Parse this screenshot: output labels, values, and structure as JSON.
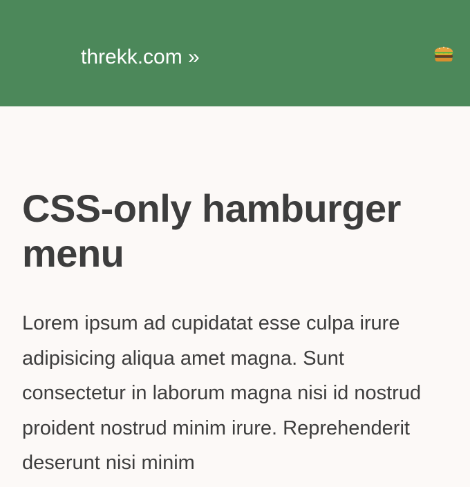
{
  "header": {
    "brand": "threkk.com »",
    "menu_icon": "hamburger-icon",
    "background": "#4c885a"
  },
  "main": {
    "title": "CSS-only hamburger menu",
    "body": "Lorem ipsum ad cupidatat esse culpa irure adipisicing aliqua amet magna. Sunt consectetur in laborum magna nisi id nostrud proident nostrud minim irure. Reprehenderit deserunt nisi minim"
  }
}
